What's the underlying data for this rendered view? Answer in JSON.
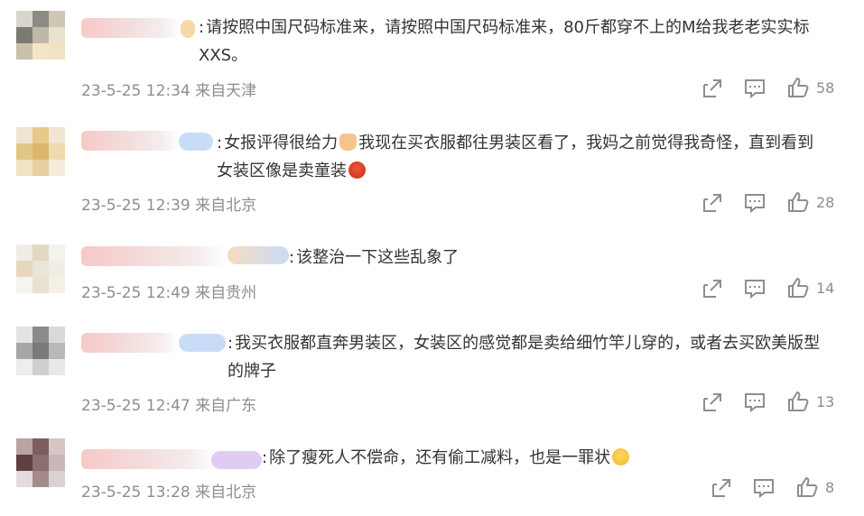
{
  "comments": [
    {
      "separator": ":",
      "text": "请按照中国尺码标准来，请按照中国尺码标准来，80斤都穿不上的M给我老老实实标XXS。",
      "date": "23-5-25 12:34",
      "location": "来自天津",
      "likes": "58"
    },
    {
      "separator": ":",
      "text_before_emoji": "女报评得很给力",
      "emoji_1": "thumbs-up-emoji",
      "text_after_emoji": "我现在买衣服都往男装区看了，我妈之前觉得我奇怪，直到看到女装区像是卖童装",
      "emoji_2": "angry-face-emoji",
      "date": "23-5-25 12:39",
      "location": "来自北京",
      "likes": "28"
    },
    {
      "separator": ":",
      "text": "该整治一下这些乱象了",
      "date": "23-5-25 12:49",
      "location": "来自贵州",
      "likes": "14"
    },
    {
      "separator": ":",
      "text": "我买衣服都直奔男装区，女装区的感觉都是卖给细竹竿儿穿的，或者去买欧美版型的牌子",
      "date": "23-5-25 12:47",
      "location": "来自广东",
      "likes": "13"
    },
    {
      "separator": ":",
      "text": "除了瘦死人不偿命，还有偷工减料，也是一罪状",
      "emoji_1": "sleepy-face-emoji",
      "date": "23-5-25 13:28",
      "location": "来自北京",
      "likes": "8"
    }
  ],
  "icons": {
    "share": "share-icon",
    "comment": "comment-icon",
    "like": "like-icon"
  },
  "colors": {
    "text": "#333333",
    "meta": "#8e8e8e",
    "icon": "#8e8e8e",
    "background": "#ffffff"
  }
}
